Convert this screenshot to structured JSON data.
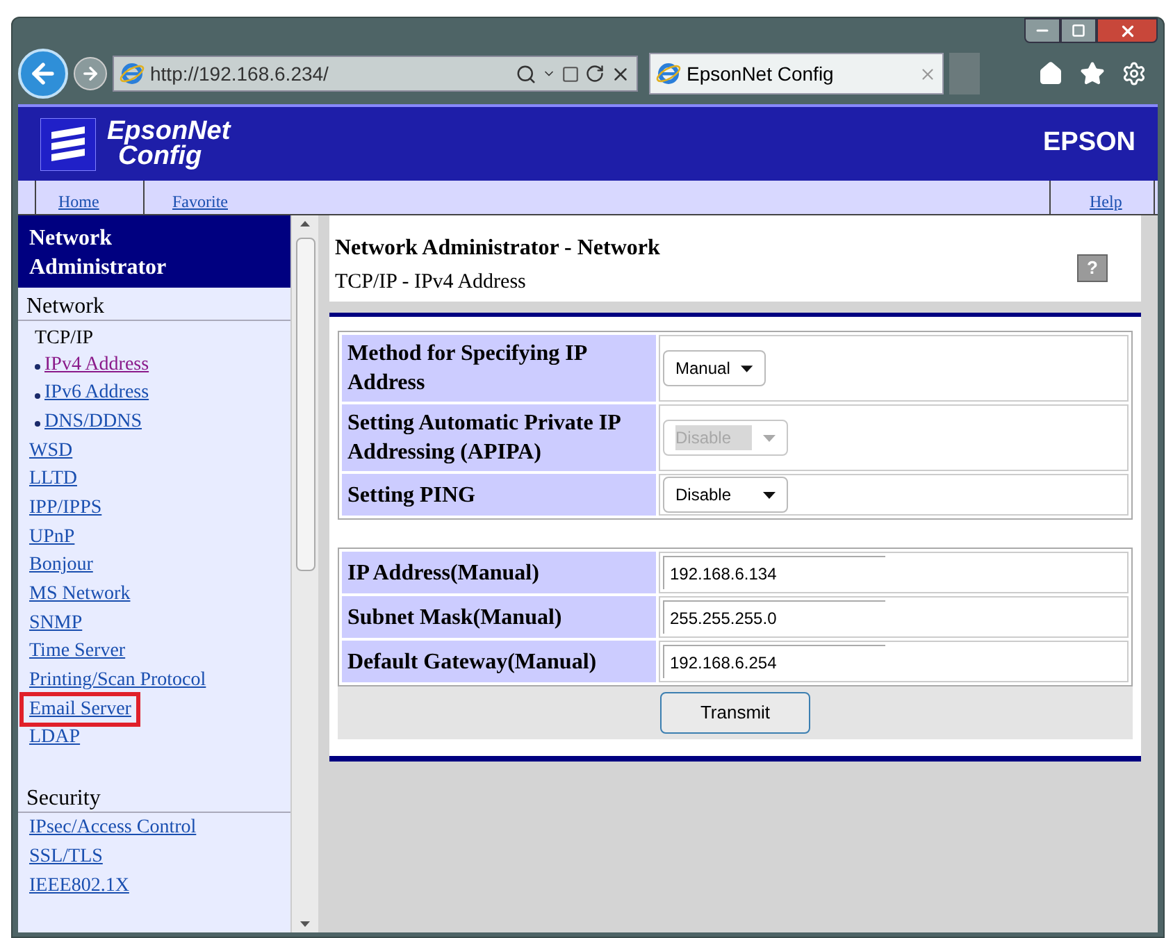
{
  "browser": {
    "address": "http://192.168.6.234/",
    "tab_title": "EpsonNet Config"
  },
  "header": {
    "logo_line1": "EpsonNet",
    "logo_line2": "Config",
    "brand": "EPSON"
  },
  "nav": {
    "links": [
      "Home",
      "Favorite"
    ],
    "help": "Help"
  },
  "sidebar": {
    "title": "Network Administrator",
    "sections": [
      {
        "heading": "Network",
        "items": [
          {
            "kind": "label",
            "label": "TCP/IP"
          },
          {
            "kind": "bullet",
            "label": "IPv4 Address",
            "selected": true,
            "highlighted": false
          },
          {
            "kind": "bullet",
            "label": "IPv6 Address",
            "selected": false,
            "highlighted": false
          },
          {
            "kind": "bullet",
            "label": "DNS/DDNS",
            "selected": false,
            "highlighted": false
          },
          {
            "kind": "link",
            "label": "WSD",
            "selected": false,
            "highlighted": false
          },
          {
            "kind": "link",
            "label": "LLTD",
            "selected": false,
            "highlighted": false
          },
          {
            "kind": "link",
            "label": "IPP/IPPS",
            "selected": false,
            "highlighted": false
          },
          {
            "kind": "link",
            "label": "UPnP",
            "selected": false,
            "highlighted": false
          },
          {
            "kind": "link",
            "label": "Bonjour",
            "selected": false,
            "highlighted": false
          },
          {
            "kind": "link",
            "label": "MS Network",
            "selected": false,
            "highlighted": false
          },
          {
            "kind": "link",
            "label": "SNMP",
            "selected": false,
            "highlighted": false
          },
          {
            "kind": "link",
            "label": "Time Server",
            "selected": false,
            "highlighted": false
          },
          {
            "kind": "link",
            "label": "Printing/Scan Protocol",
            "selected": false,
            "highlighted": false
          },
          {
            "kind": "link",
            "label": "Email Server",
            "selected": false,
            "highlighted": true
          },
          {
            "kind": "link",
            "label": "LDAP",
            "selected": false,
            "highlighted": false
          }
        ]
      },
      {
        "heading": "Security",
        "items": [
          {
            "kind": "link",
            "label": "IPsec/Access Control",
            "selected": false,
            "highlighted": false
          },
          {
            "kind": "link",
            "label": "SSL/TLS",
            "selected": false,
            "highlighted": false
          },
          {
            "kind": "link",
            "label": "IEEE802.1X",
            "selected": false,
            "highlighted": false
          }
        ]
      }
    ]
  },
  "main": {
    "title": "Network Administrator - Network",
    "subtitle": "TCP/IP - IPv4 Address",
    "help": "?",
    "groups": [
      [
        {
          "label": "Method for Specifying IP Address",
          "kind": "select",
          "value": "Manual",
          "disabled": false
        },
        {
          "label": "Setting Automatic Private IP Addressing (APIPA)",
          "kind": "select",
          "value": "Disable",
          "disabled": true
        },
        {
          "label": "Setting PING",
          "kind": "select",
          "value": "Disable",
          "disabled": false
        }
      ],
      [
        {
          "label": "IP Address(Manual)",
          "kind": "text",
          "value": "192.168.6.134"
        },
        {
          "label": "Subnet Mask(Manual)",
          "kind": "text",
          "value": "255.255.255.0"
        },
        {
          "label": "Default Gateway(Manual)",
          "kind": "text",
          "value": "192.168.6.254"
        }
      ]
    ],
    "button": "Transmit"
  }
}
